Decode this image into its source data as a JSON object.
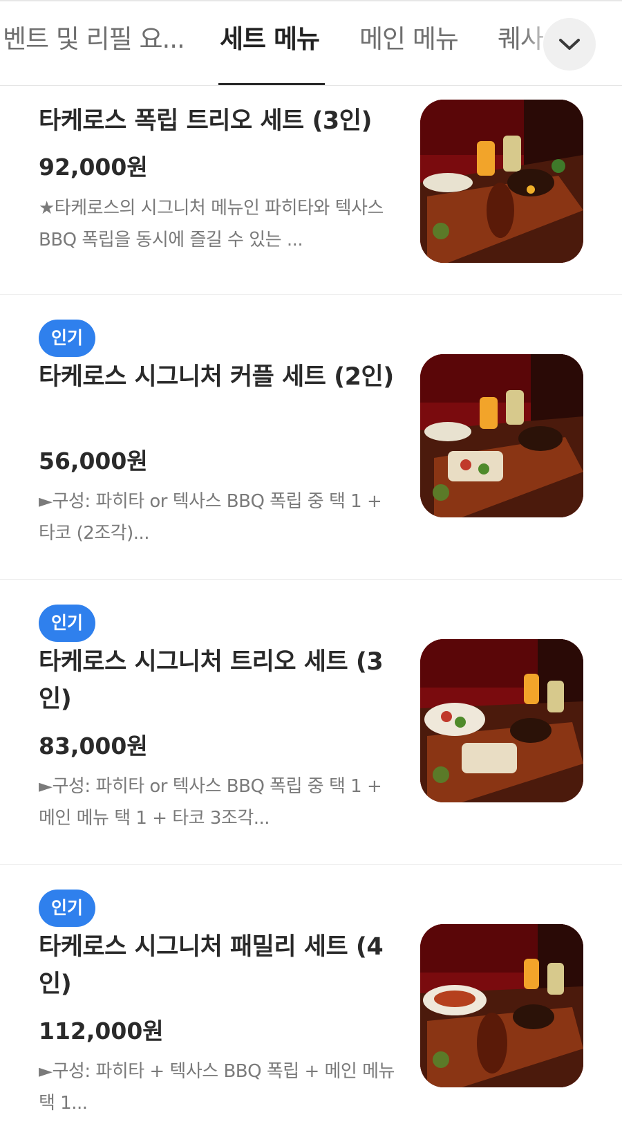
{
  "tabs": [
    {
      "label": "벤트 및 리필 요...",
      "active": false
    },
    {
      "label": "세트 메뉴",
      "active": true
    },
    {
      "label": "메인 메뉴",
      "active": false
    },
    {
      "label": "퀘사",
      "active": false
    }
  ],
  "tab_expand_icon": "chevron-down-icon",
  "items": [
    {
      "badge": "",
      "title": "타케로스 폭립 트리오 세트 (3인)",
      "price": "92,000원",
      "description": "★타케로스의 시그니처 메뉴인 파히타와 텍사스 BBQ 폭립을 동시에 즐길 수 있는 ..."
    },
    {
      "badge": "인기",
      "title": "타케로스 시그니처 커플 세트 (2인)",
      "price": "56,000원",
      "description": "►구성: 파히타 or 텍사스 BBQ 폭립 중 택 1 + 타코 (2조각)..."
    },
    {
      "badge": "인기",
      "title": "타케로스 시그니처 트리오 세트 (3인)",
      "price": "83,000원",
      "description": "►구성: 파히타 or 텍사스 BBQ 폭립 중 택 1 + 메인 메뉴 택 1 + 타코  3조각..."
    },
    {
      "badge": "인기",
      "title": "타케로스 시그니처 패밀리 세트 (4인)",
      "price": "112,000원",
      "description": "►구성: 파히타 + 텍사스 BBQ 폭립 + 메인 메뉴 택 1..."
    }
  ],
  "colors": {
    "badge_bg": "#2f80ed",
    "active_tab": "#222222",
    "inactive_tab": "#6f6f6f",
    "description": "#7a7a7a"
  }
}
